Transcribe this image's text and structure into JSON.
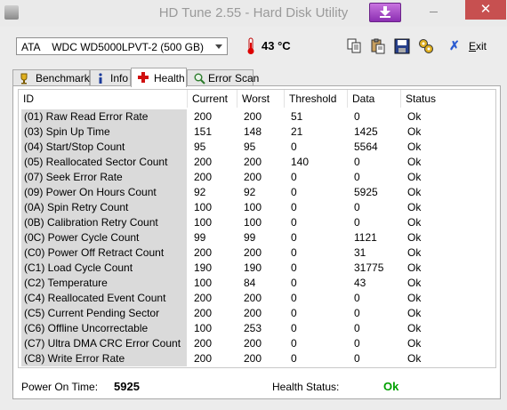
{
  "window": {
    "title": "HD Tune 2.55 - Hard Disk Utility",
    "close_glyph": "✕"
  },
  "toolbar": {
    "drive": "ATA    WDC WD5000LPVT-2 (500 GB)",
    "temperature": "43 °C",
    "exit_mnemonic": "E",
    "exit_rest": "xit"
  },
  "tabs": [
    {
      "label": "Benchmark",
      "icon": "trophy-icon"
    },
    {
      "label": "Info",
      "icon": "info-icon"
    },
    {
      "label": "Health",
      "icon": "health-cross-icon"
    },
    {
      "label": "Error Scan",
      "icon": "magnifier-icon"
    }
  ],
  "active_tab": "Health",
  "table": {
    "columns": {
      "id": "ID",
      "current": "Current",
      "worst": "Worst",
      "threshold": "Threshold",
      "data": "Data",
      "status": "Status"
    },
    "rows": [
      {
        "id": "(01) Raw Read Error Rate",
        "current": "200",
        "worst": "200",
        "threshold": "51",
        "data": "0",
        "status": "Ok"
      },
      {
        "id": "(03) Spin Up Time",
        "current": "151",
        "worst": "148",
        "threshold": "21",
        "data": "1425",
        "status": "Ok"
      },
      {
        "id": "(04) Start/Stop Count",
        "current": "95",
        "worst": "95",
        "threshold": "0",
        "data": "5564",
        "status": "Ok"
      },
      {
        "id": "(05) Reallocated Sector Count",
        "current": "200",
        "worst": "200",
        "threshold": "140",
        "data": "0",
        "status": "Ok"
      },
      {
        "id": "(07) Seek Error Rate",
        "current": "200",
        "worst": "200",
        "threshold": "0",
        "data": "0",
        "status": "Ok"
      },
      {
        "id": "(09) Power On Hours Count",
        "current": "92",
        "worst": "92",
        "threshold": "0",
        "data": "5925",
        "status": "Ok"
      },
      {
        "id": "(0A) Spin Retry Count",
        "current": "100",
        "worst": "100",
        "threshold": "0",
        "data": "0",
        "status": "Ok"
      },
      {
        "id": "(0B) Calibration Retry Count",
        "current": "100",
        "worst": "100",
        "threshold": "0",
        "data": "0",
        "status": "Ok"
      },
      {
        "id": "(0C) Power Cycle Count",
        "current": "99",
        "worst": "99",
        "threshold": "0",
        "data": "1121",
        "status": "Ok"
      },
      {
        "id": "(C0) Power Off Retract Count",
        "current": "200",
        "worst": "200",
        "threshold": "0",
        "data": "31",
        "status": "Ok"
      },
      {
        "id": "(C1) Load Cycle Count",
        "current": "190",
        "worst": "190",
        "threshold": "0",
        "data": "31775",
        "status": "Ok"
      },
      {
        "id": "(C2) Temperature",
        "current": "100",
        "worst": "84",
        "threshold": "0",
        "data": "43",
        "status": "Ok"
      },
      {
        "id": "(C4) Reallocated Event Count",
        "current": "200",
        "worst": "200",
        "threshold": "0",
        "data": "0",
        "status": "Ok"
      },
      {
        "id": "(C5) Current Pending Sector",
        "current": "200",
        "worst": "200",
        "threshold": "0",
        "data": "0",
        "status": "Ok"
      },
      {
        "id": "(C6) Offline Uncorrectable",
        "current": "100",
        "worst": "253",
        "threshold": "0",
        "data": "0",
        "status": "Ok"
      },
      {
        "id": "(C7) Ultra DMA CRC Error Count",
        "current": "200",
        "worst": "200",
        "threshold": "0",
        "data": "0",
        "status": "Ok"
      },
      {
        "id": "(C8) Write Error Rate",
        "current": "200",
        "worst": "200",
        "threshold": "0",
        "data": "0",
        "status": "Ok"
      }
    ]
  },
  "footer": {
    "power_on_label": "Power On Time:",
    "power_on_value": "5925",
    "health_label": "Health Status:",
    "health_value": "Ok"
  },
  "colors": {
    "health_ok": "#00a000",
    "accent_tray": "#a040c8",
    "close": "#c75050"
  }
}
